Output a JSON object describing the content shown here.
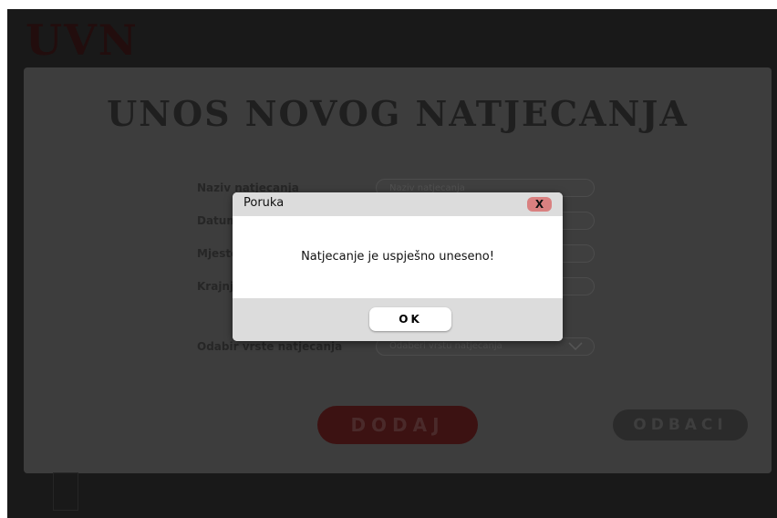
{
  "app": {
    "logo": "UVN"
  },
  "nav": {
    "items": [
      "",
      ""
    ]
  },
  "form": {
    "title": "UNOS NOVOG NATJECANJA",
    "fields": [
      {
        "label": "Naziv natjecanja",
        "placeholder": "Naziv natjecanja"
      },
      {
        "label": "Datum",
        "placeholder": ""
      },
      {
        "label": "Mjesto",
        "placeholder": ""
      },
      {
        "label": "Krajnji",
        "placeholder": ""
      }
    ],
    "select": {
      "label": "Odabir vrste natjecanja",
      "value": "Odaberi vrstu natjecanja"
    },
    "add_label": "DODAJ",
    "discard_label": "ODBACI"
  },
  "footer": {
    "text": ""
  },
  "modal": {
    "title": "Poruka",
    "close_label": "X",
    "message": "Natjecanje je uspješno uneseno!",
    "ok_label": "OK"
  },
  "colors": {
    "close_button": "#d98080",
    "modal_header": "#dcdcdc",
    "overlay_bg": "#191919"
  }
}
